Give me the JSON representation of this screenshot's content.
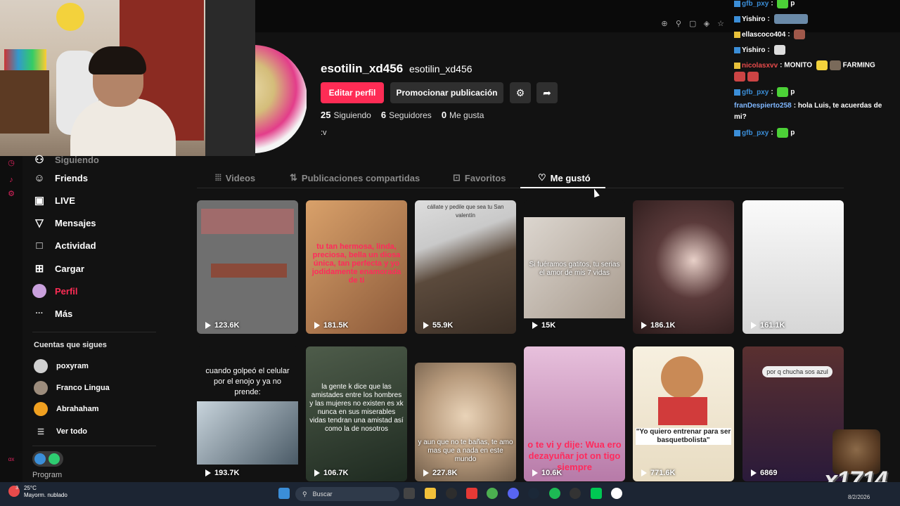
{
  "chat": {
    "lines": [
      {
        "user": "gfb_pxy",
        "text": "p",
        "color": "#3b8ed8"
      },
      {
        "user": "Yishiro",
        "text": "",
        "color": "#ffffff"
      },
      {
        "user": "ellascoco404",
        "text": "",
        "color": "#ffffff"
      },
      {
        "user": "Yishiro",
        "text": "",
        "color": "#ffffff"
      },
      {
        "user": "nicolasxvv",
        "text": "MONITO",
        "text2": "FARMING",
        "color": "#e94b4b"
      },
      {
        "user": "gfb_pxy",
        "text": "p",
        "color": "#3b8ed8"
      },
      {
        "user": "franDespierto258",
        "text": "hola Luis, te acuerdas de",
        "text2": "mi?",
        "color": "#7fb7ff"
      },
      {
        "user": "gfb_pxy",
        "text": "p",
        "color": "#3b8ed8"
      }
    ]
  },
  "sidebar": {
    "partial_item": "Siguiendo",
    "items": [
      {
        "label": "Friends",
        "icon": "friends-icon",
        "glyph": "☺"
      },
      {
        "label": "LIVE",
        "icon": "live-icon",
        "glyph": "▣"
      },
      {
        "label": "Mensajes",
        "icon": "messages-icon",
        "glyph": "▽"
      },
      {
        "label": "Actividad",
        "icon": "activity-icon",
        "glyph": "□"
      },
      {
        "label": "Cargar",
        "icon": "upload-icon",
        "glyph": "⊞"
      },
      {
        "label": "Perfil",
        "icon": "profile-icon",
        "glyph": "●"
      },
      {
        "label": "Más",
        "icon": "more-icon",
        "glyph": "···"
      }
    ],
    "following_title": "Cuentas que sigues",
    "accounts": [
      {
        "name": "poxyram",
        "color": "#d0d0d0"
      },
      {
        "name": "Franco Lingua",
        "color": "#9c8c7c"
      },
      {
        "name": "Abrahaham",
        "color": "#f0a020"
      }
    ],
    "see_all": "Ver todo",
    "promo_text": "Program"
  },
  "profile": {
    "username": "esotilin_xd456",
    "handle": "esotilin_xd456",
    "edit_button": "Editar perfil",
    "promote_button": "Promocionar publicación",
    "following_count": "25",
    "following_label": "Siguiendo",
    "followers_count": "6",
    "followers_label": "Seguidores",
    "likes_count": "0",
    "likes_label": "Me gusta",
    "bio": ":v"
  },
  "tabs": [
    {
      "label": "Videos",
      "icon": "grid-icon"
    },
    {
      "label": "Publicaciones compartidas",
      "icon": "repost-icon"
    },
    {
      "label": "Favoritos",
      "icon": "bookmark-icon"
    },
    {
      "label": "Me gustó",
      "icon": "heart-icon",
      "active": true
    }
  ],
  "videos": [
    {
      "views": "123.6K",
      "caption": "",
      "bg": "#6f6f6f"
    },
    {
      "views": "181.5K",
      "caption": "tu tan hermosa, linda, preciosa, bella un diosa única, tan perfecta y yo jodidamente enamorada de ti",
      "bg": "#c98a56"
    },
    {
      "views": "55.9K",
      "caption": "cállate y pedile que sea tu San valentín",
      "bg": "#5b4a3c"
    },
    {
      "views": "15K",
      "caption": "Si fuéramos gatitos, tu serias el amor de mis 7 vidas",
      "bg": "#cfc9c3"
    },
    {
      "views": "186.1K",
      "caption": "",
      "bg": "#4a3a3a"
    },
    {
      "views": "161.1K",
      "caption": "",
      "bg": "#e8e8e8"
    },
    {
      "views": "193.7K",
      "caption": "cuando golpeó el celular por el enojo y ya no prende:",
      "bg": "#1a1a1a"
    },
    {
      "views": "106.7K",
      "caption": "la gente k dice que las amistades entre los hombres y las mujeres no existen es xk nunca en sus miserables vidas tendran una amistad así como la de nosotros",
      "bg": "#3c4a3a"
    },
    {
      "views": "227.8K",
      "caption": "y aun que no te bañas, te amo mas que a nada en este mundo",
      "bg": "#b79a7c"
    },
    {
      "views": "10.6K",
      "caption": "o te vi y dije: Wua ero dezayuñar jot on tigo siempre",
      "bg": "#d9a9c9"
    },
    {
      "views": "771.6K",
      "caption": "\"Yo quiero entrenar para ser basquetbolista\"",
      "bg": "#f3ead8"
    },
    {
      "views": "6869",
      "caption": "por q chucha sos azul",
      "bg": "#4a2b2b"
    }
  ],
  "taskbar": {
    "temp": "25°C",
    "weather": "Mayorm. nublado",
    "search": "Buscar",
    "date": "8/2/2026",
    "badge": "3"
  },
  "overlay": {
    "text": "x1714"
  }
}
